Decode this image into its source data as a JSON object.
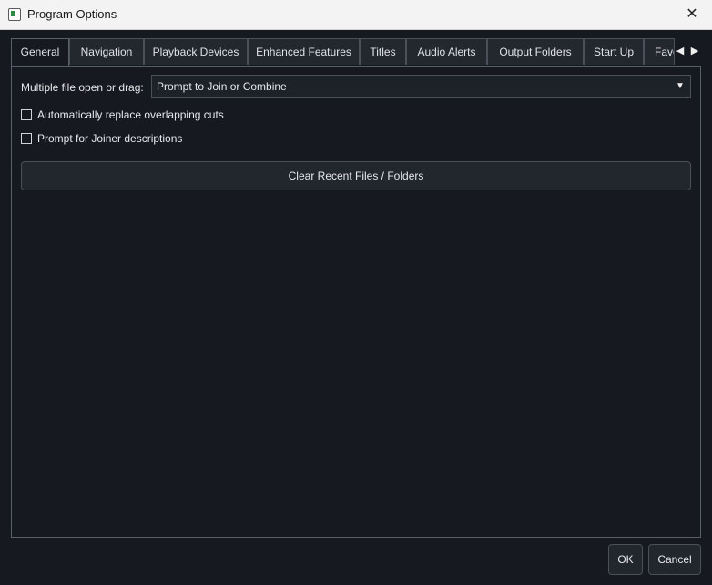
{
  "window": {
    "title": "Program Options",
    "close_glyph": "✕",
    "icon": "app-window-icon"
  },
  "tabs": [
    {
      "label": "General",
      "active": true
    },
    {
      "label": "Navigation",
      "active": false
    },
    {
      "label": "Playback Devices",
      "active": false
    },
    {
      "label": "Enhanced Features",
      "active": false
    },
    {
      "label": "Titles",
      "active": false
    },
    {
      "label": "Audio Alerts",
      "active": false
    },
    {
      "label": "Output  Folders",
      "active": false
    },
    {
      "label": "Start Up",
      "active": false
    },
    {
      "label": "Favo",
      "active": false
    }
  ],
  "tab_scroll": {
    "left_glyph": "◀",
    "right_glyph": "▶"
  },
  "general": {
    "multi_open_label": "Multiple file open or drag:",
    "multi_open_value": "Prompt to Join or Combine",
    "dropdown_glyph": "▼",
    "checkboxes": [
      {
        "label": "Automatically replace overlapping cuts",
        "checked": false
      },
      {
        "label": "Prompt for Joiner descriptions",
        "checked": false
      }
    ],
    "clear_recent_label": "Clear Recent Files / Folders"
  },
  "footer": {
    "ok_label": "OK",
    "cancel_label": "Cancel"
  },
  "colors": {
    "background": "#16191f",
    "titlebar": "#f3f3f3",
    "border": "#4a4f58"
  }
}
